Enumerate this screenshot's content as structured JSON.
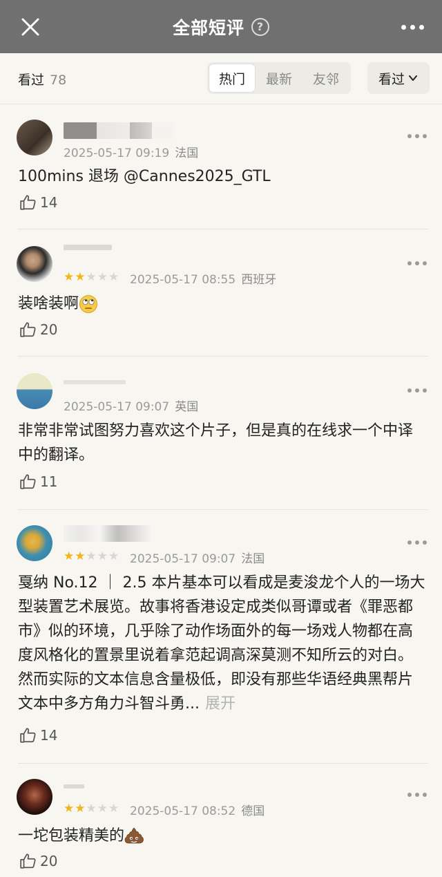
{
  "header": {
    "title": "全部短评",
    "help_icon": "question-circle-icon",
    "close_icon": "close-icon",
    "more_icon": "more-dots-icon"
  },
  "filter": {
    "seen_label": "看过",
    "seen_count": "78",
    "tabs": [
      {
        "label": "热门",
        "active": true
      },
      {
        "label": "最新",
        "active": false
      },
      {
        "label": "友邻",
        "active": false
      }
    ],
    "dropdown_label": "看过"
  },
  "comments": [
    {
      "rating": 0,
      "date": "2025-05-17 09:19",
      "location": "法国",
      "text": "100mins 退场 @Cannes2025_GTL",
      "likes": "14"
    },
    {
      "rating": 2,
      "date": "2025-05-17 08:55",
      "location": "西班牙",
      "text": "装啥装啊",
      "emoji": "eye-roll-emoji",
      "likes": "20"
    },
    {
      "rating": 0,
      "date": "2025-05-17 09:07",
      "location": "英国",
      "text": "非常非常试图努力喜欢这个片子，但是真的在线求一个中译中的翻译。",
      "likes": "11"
    },
    {
      "rating": 2,
      "date": "2025-05-17 09:07",
      "location": "法国",
      "text": "戛纳 No.12 ｜ 2.5 本片基本可以看成是麦浚龙个人的一场大型装置艺术展览。故事将香港设定成类似哥谭或者《罪恶都市》似的环境，几乎除了动作场面外的每一场戏人物都在高度风格化的置景里说着拿范起调高深莫测不知所云的对白。然而实际的文本信息含量极低，即没有那些华语经典黑帮片文本中多方角力斗智斗勇...",
      "expand_label": "展开",
      "likes": "14"
    },
    {
      "rating": 2,
      "date": "2025-05-17 08:52",
      "location": "德国",
      "text": "一坨包装精美的",
      "emoji": "poop-emoji",
      "likes": "20"
    }
  ],
  "colors": {
    "topbar": "#707070",
    "background": "#f8f6f1",
    "star_on": "#f2b51a",
    "star_off": "#d6d6d6"
  }
}
